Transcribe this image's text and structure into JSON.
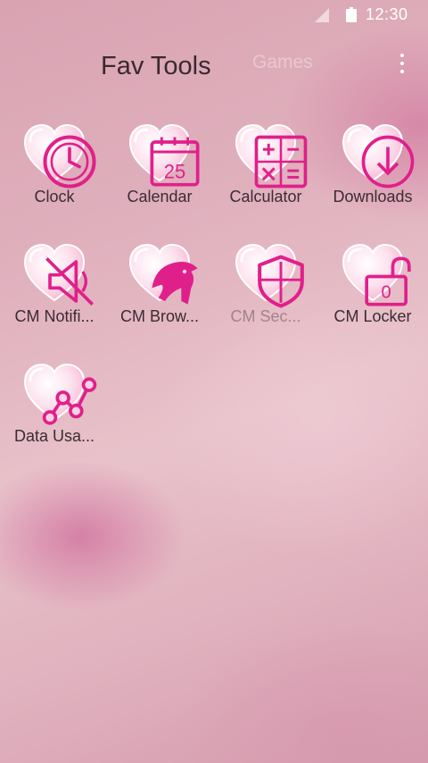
{
  "status_bar": {
    "time": "12:30"
  },
  "header": {
    "active_tab": "Fav Tools",
    "inactive_tab": "Games"
  },
  "apps": [
    {
      "label": "Clock",
      "icon": "clock-icon"
    },
    {
      "label": "Calendar",
      "icon": "calendar-icon",
      "icon_text": "25"
    },
    {
      "label": "Calculator",
      "icon": "calculator-icon",
      "icon_text": "+−×="
    },
    {
      "label": "Downloads",
      "icon": "download-icon"
    },
    {
      "label": "CM Notifi...",
      "icon": "notification-speaker-icon"
    },
    {
      "label": "CM Brow...",
      "icon": "browser-lion-icon"
    },
    {
      "label": "CM Sec...",
      "icon": "shield-icon"
    },
    {
      "label": "CM Locker",
      "icon": "lock-icon",
      "icon_text": "0"
    },
    {
      "label": "Data Usa...",
      "icon": "data-graph-icon"
    }
  ],
  "colors": {
    "accent": "#e0208a",
    "heart_fill": "#fbd3e4",
    "label": "#3b2b33"
  }
}
